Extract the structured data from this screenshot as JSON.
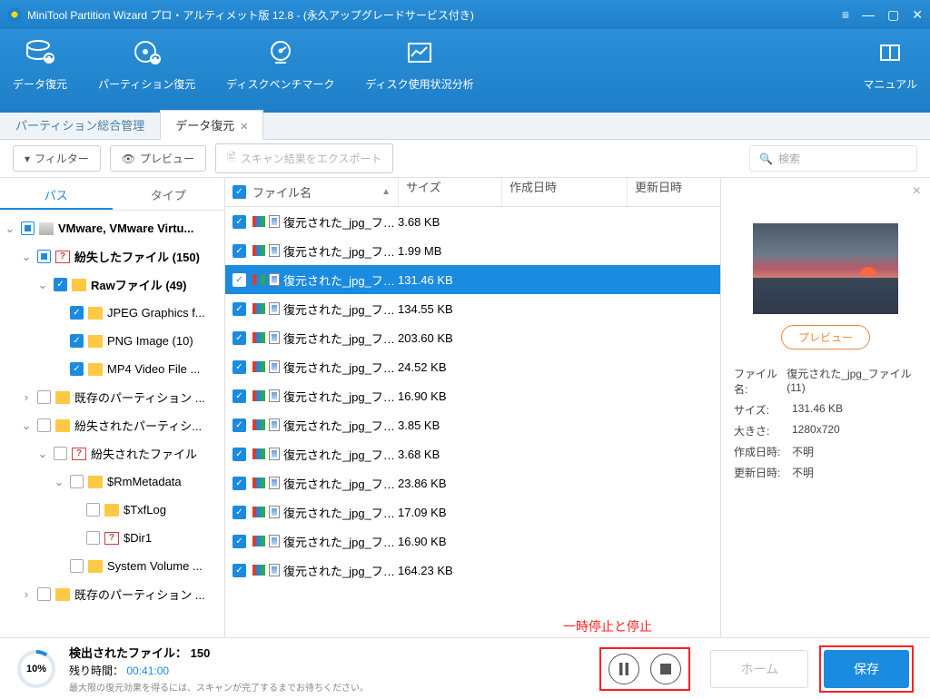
{
  "titlebar": {
    "title": "MiniTool Partition Wizard プロ・アルティメット版 12.8 - (永久アップグレードサービス付き)"
  },
  "ribbon": {
    "items": [
      {
        "label": "データ復元"
      },
      {
        "label": "パーティション復元"
      },
      {
        "label": "ディスクベンチマーク"
      },
      {
        "label": "ディスク使用状況分析"
      }
    ],
    "manual": "マニュアル"
  },
  "tabs": {
    "t0": "パーティション総合管理",
    "t1": "データ復元"
  },
  "toolbar": {
    "filter": "フィルター",
    "preview": "プレビュー",
    "export": "スキャン結果をエクスポート",
    "search": "検索"
  },
  "treeTabs": {
    "path": "パス",
    "type": "タイプ"
  },
  "tree": [
    {
      "indent": 0,
      "chev": "⌄",
      "cb": "partial",
      "icon": "disk",
      "label": "VMware, VMware Virtu...",
      "bold": true
    },
    {
      "indent": 1,
      "chev": "⌄",
      "cb": "partial",
      "icon": "q",
      "label": "紛失したファイル (150)",
      "bold": true
    },
    {
      "indent": 2,
      "chev": "⌄",
      "cb": "checked",
      "icon": "folder",
      "label": "Rawファイル (49)",
      "bold": true
    },
    {
      "indent": 3,
      "chev": "",
      "cb": "checked",
      "icon": "folder",
      "label": "JPEG Graphics f..."
    },
    {
      "indent": 3,
      "chev": "",
      "cb": "checked",
      "icon": "folder",
      "label": "PNG Image (10)"
    },
    {
      "indent": 3,
      "chev": "",
      "cb": "checked",
      "icon": "folder",
      "label": "MP4 Video File ..."
    },
    {
      "indent": 1,
      "chev": "›",
      "cb": "empty",
      "icon": "folder",
      "label": "既存のパーティション ..."
    },
    {
      "indent": 1,
      "chev": "⌄",
      "cb": "empty",
      "icon": "folder",
      "label": "紛失されたパーティシ..."
    },
    {
      "indent": 2,
      "chev": "⌄",
      "cb": "empty",
      "icon": "q",
      "label": "紛失されたファイル"
    },
    {
      "indent": 3,
      "chev": "⌄",
      "cb": "empty",
      "icon": "folder",
      "label": "$RmMetadata"
    },
    {
      "indent": 4,
      "chev": "",
      "cb": "empty",
      "icon": "folder",
      "label": "$TxfLog"
    },
    {
      "indent": 4,
      "chev": "",
      "cb": "empty",
      "icon": "q",
      "label": "$Dir1"
    },
    {
      "indent": 3,
      "chev": "",
      "cb": "empty",
      "icon": "folder",
      "label": "System Volume ..."
    },
    {
      "indent": 1,
      "chev": "›",
      "cb": "empty",
      "icon": "folder",
      "label": "既存のパーティション ..."
    }
  ],
  "fileHeader": {
    "name": "ファイル名",
    "size": "サイズ",
    "created": "作成日時",
    "modified": "更新日時"
  },
  "files": [
    {
      "name": "復元された_jpg_ファイ...",
      "size": "3.68 KB"
    },
    {
      "name": "復元された_jpg_ファイ...",
      "size": "1.99 MB"
    },
    {
      "name": "復元された_jpg_ファイ...",
      "size": "131.46 KB",
      "selected": true
    },
    {
      "name": "復元された_jpg_ファイ...",
      "size": "134.55 KB"
    },
    {
      "name": "復元された_jpg_ファイ...",
      "size": "203.60 KB"
    },
    {
      "name": "復元された_jpg_ファイ...",
      "size": "24.52 KB"
    },
    {
      "name": "復元された_jpg_ファイ...",
      "size": "16.90 KB"
    },
    {
      "name": "復元された_jpg_ファイ...",
      "size": "3.85 KB"
    },
    {
      "name": "復元された_jpg_ファイ...",
      "size": "3.68 KB"
    },
    {
      "name": "復元された_jpg_ファイ...",
      "size": "23.86 KB"
    },
    {
      "name": "復元された_jpg_ファイ...",
      "size": "17.09 KB"
    },
    {
      "name": "復元された_jpg_ファイ...",
      "size": "16.90 KB"
    },
    {
      "name": "復元された_jpg_ファイ...",
      "size": "164.23 KB"
    }
  ],
  "preview": {
    "button": "プレビュー",
    "meta": {
      "filename_k": "ファイル名:",
      "filename_v": "復元された_jpg_ファイル(11)",
      "size_k": "サイズ:",
      "size_v": "131.46 KB",
      "dim_k": "大きさ:",
      "dim_v": "1280x720",
      "created_k": "作成日時:",
      "created_v": "不明",
      "modified_k": "更新日時:",
      "modified_v": "不明"
    }
  },
  "annotation": "一時停止と停止",
  "footer": {
    "pct": "10%",
    "l1": "検出されたファイル： 150",
    "l2a": "残り時間：",
    "l2b": "00:41:00",
    "l3": "最大限の復元効果を得るには、スキャンが完了するまでお待ちください。",
    "home": "ホーム",
    "save": "保存"
  }
}
